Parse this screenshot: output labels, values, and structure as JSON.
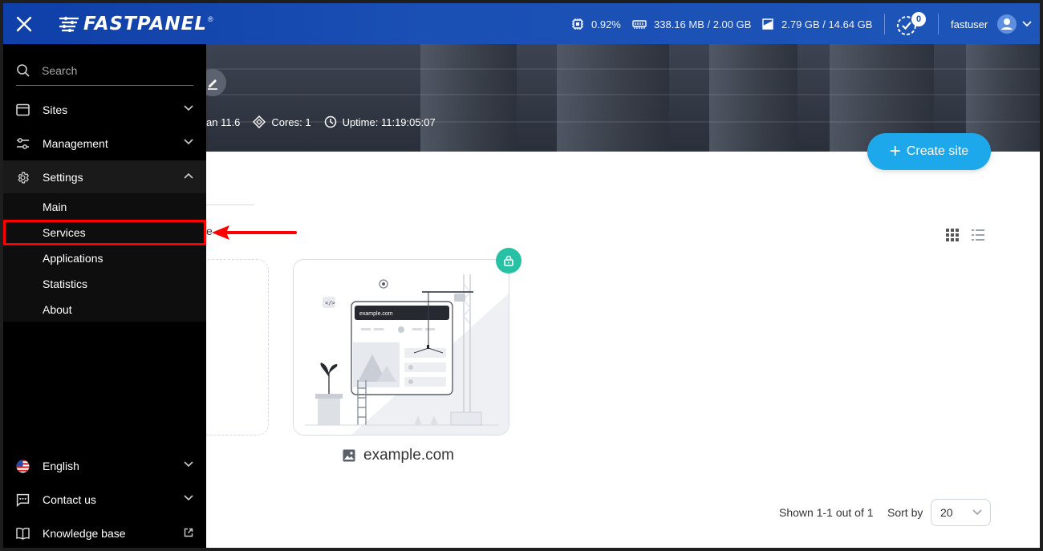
{
  "topbar": {
    "logo_text": "FASTPANEL",
    "logo_mark": "®",
    "cpu": "0.92%",
    "ram": "338.16 MB / 2.00 GB",
    "disk": "2.79 GB / 14.64 GB",
    "tasks_count": "0",
    "username": "fastuser"
  },
  "hero": {
    "os_fragment": "an 11.6",
    "cores": "Cores: 1",
    "uptime": "Uptime: 11:19:05:07"
  },
  "main": {
    "create_site_label": "Create site",
    "site_name": "example.com",
    "site_preview_domain": "example.com",
    "partial_tab_char": "e",
    "shown_text": "Shown 1-1 out of 1",
    "sort_label": "Sort by",
    "sort_value": "20"
  },
  "sidebar": {
    "search_placeholder": "Search",
    "items": [
      {
        "label": "Sites"
      },
      {
        "label": "Management"
      },
      {
        "label": "Settings"
      }
    ],
    "submenu": [
      {
        "label": "Main"
      },
      {
        "label": "Services"
      },
      {
        "label": "Applications"
      },
      {
        "label": "Statistics"
      },
      {
        "label": "About"
      }
    ],
    "bottom": [
      {
        "label": "English"
      },
      {
        "label": "Contact us"
      },
      {
        "label": "Knowledge base"
      }
    ]
  },
  "colors": {
    "topbar": "#1a4fb4",
    "accent": "#1ea8ec",
    "lock_badge": "#27c1a5",
    "highlight": "#ff0000"
  }
}
